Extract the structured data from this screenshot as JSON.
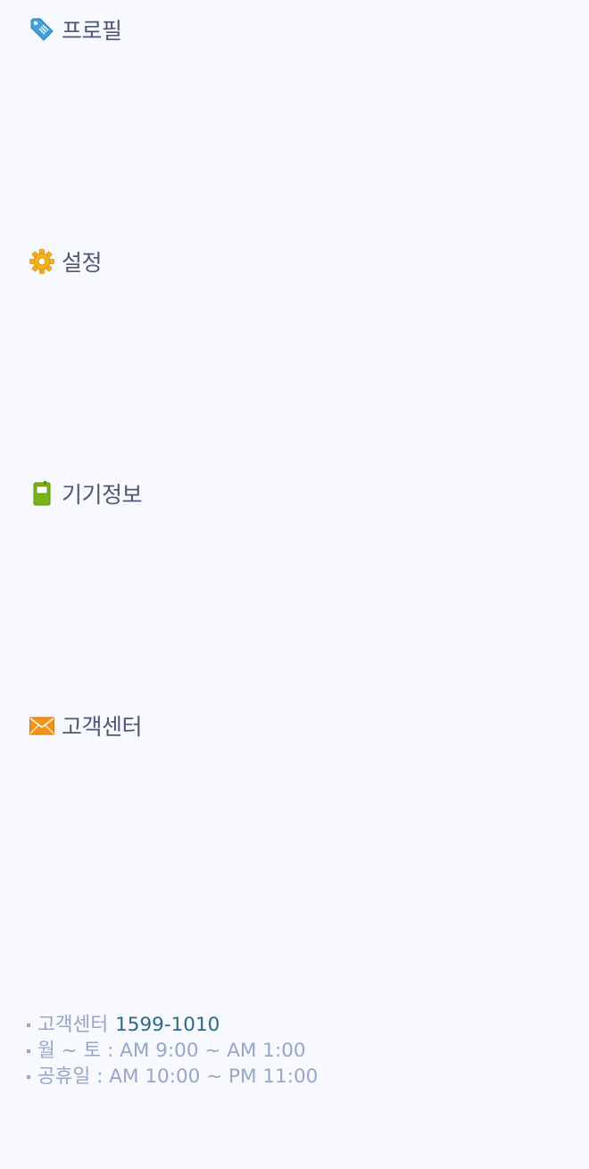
{
  "menu": {
    "profile": {
      "label": "프로필",
      "icon": "tag-icon",
      "color": "#3ea0dc"
    },
    "settings": {
      "label": "설정",
      "icon": "gear-icon",
      "color": "#f3b11c"
    },
    "device_info": {
      "label": "기기정보",
      "icon": "device-icon",
      "color": "#7ab317"
    },
    "customer_center": {
      "label": "고객센터",
      "icon": "envelope-icon",
      "color": "#f39418"
    }
  },
  "footer": {
    "support_label": "고객센터",
    "support_phone": "1599-1010",
    "weekday_hours": "월 ~ 토 : AM 9:00 ~ AM 1:00",
    "holiday_hours": "공휴일 : AM 10:00 ~ PM 11:00"
  }
}
